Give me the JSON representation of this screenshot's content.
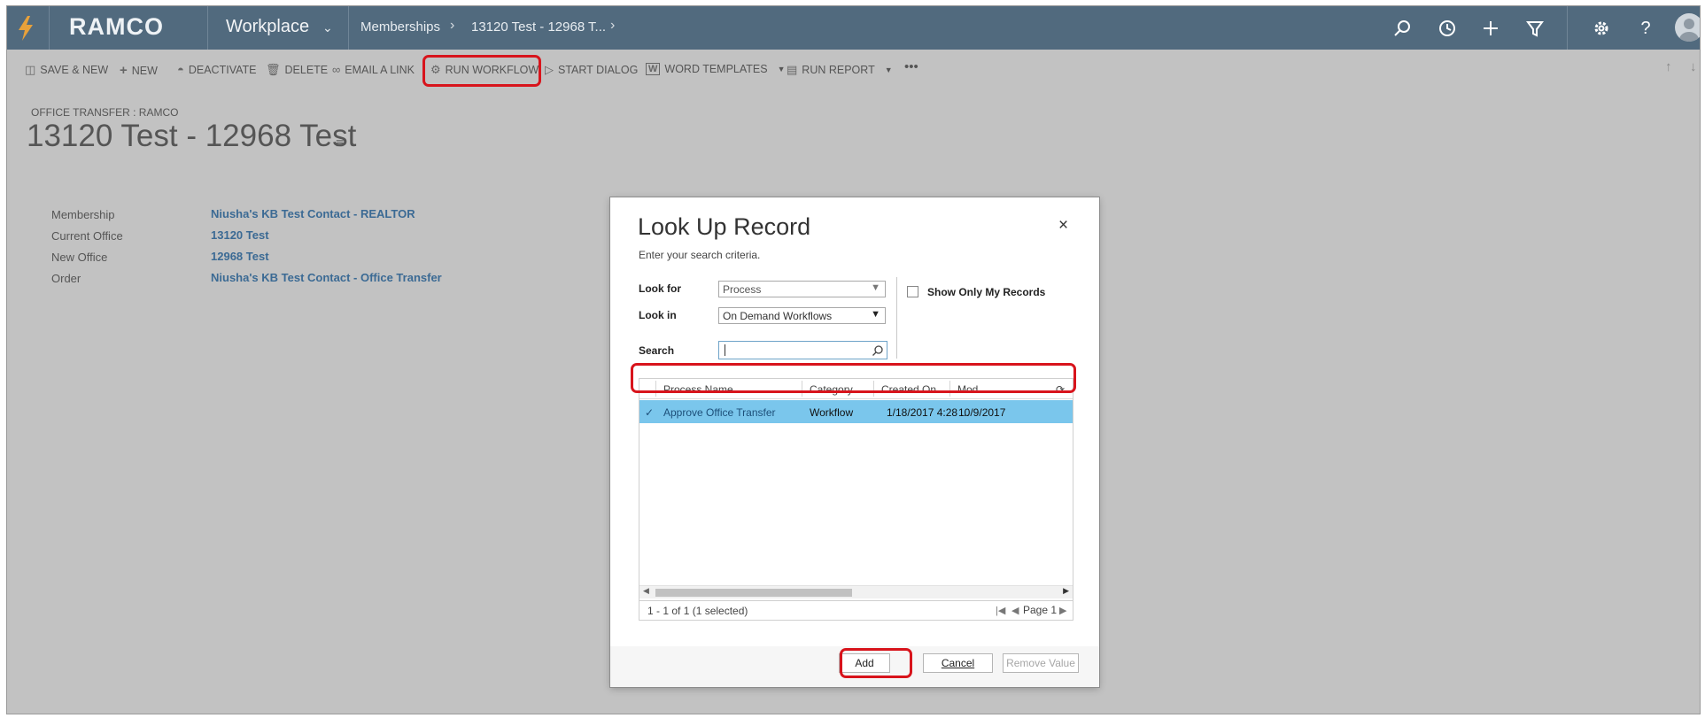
{
  "nav": {
    "logo_text": "RAMCO",
    "app_name": "Workplace",
    "breadcrumbs": [
      "Memberships",
      "13120 Test - 12968 T..."
    ],
    "icons": [
      "search-icon",
      "history-icon",
      "plus-icon",
      "filter-icon",
      "settings-icon",
      "help-icon",
      "user-avatar"
    ]
  },
  "commandbar": {
    "items": [
      {
        "label": "SAVE & NEW",
        "icon": "save-new-icon"
      },
      {
        "label": "NEW",
        "icon": "plus-icon"
      },
      {
        "label": "DEACTIVATE",
        "icon": "deactivate-icon"
      },
      {
        "label": "DELETE",
        "icon": "trash-icon"
      },
      {
        "label": "EMAIL A LINK",
        "icon": "link-icon"
      },
      {
        "label": "RUN WORKFLOW",
        "icon": "workflow-icon"
      },
      {
        "label": "START DIALOG",
        "icon": "dialog-icon"
      },
      {
        "label": "WORD TEMPLATES",
        "icon": "word-icon"
      },
      {
        "label": "RUN REPORT",
        "icon": "report-icon"
      }
    ],
    "more": "•••"
  },
  "record": {
    "entity_label": "OFFICE TRANSFER : RAMCO",
    "title": "13120 Test - 12968 Test",
    "fields": [
      {
        "label": "Membership",
        "value": "Niusha's KB Test Contact - REALTOR"
      },
      {
        "label": "Current Office",
        "value": "13120 Test"
      },
      {
        "label": "New Office",
        "value": "12968 Test"
      },
      {
        "label": "Order",
        "value": "Niusha's KB Test Contact - Office Transfer"
      }
    ]
  },
  "dialog": {
    "title": "Look Up Record",
    "subtitle": "Enter your search criteria.",
    "close": "×",
    "look_for_label": "Look for",
    "look_for_value": "Process",
    "look_in_label": "Look in",
    "look_in_value": "On Demand Workflows",
    "search_label": "Search",
    "search_value": "",
    "show_only_mine_label": "Show Only My Records",
    "show_only_mine_checked": false,
    "grid": {
      "columns": [
        "Process Name",
        "Category",
        "Created On",
        "Mod"
      ],
      "rows": [
        {
          "selected": true,
          "process_name": "Approve Office Transfer",
          "category": "Workflow",
          "created_on": "1/18/2017 4:28 ...",
          "modified_on": "10/9/2017"
        }
      ]
    },
    "status": "1 - 1 of 1 (1 selected)",
    "page_label": "Page 1",
    "buttons": {
      "add": "Add",
      "cancel": "Cancel",
      "remove": "Remove Value"
    }
  },
  "colors": {
    "nav_bg": "#516a7e",
    "selected_row": "#7ac6ec",
    "highlight": "#d8141c",
    "link": "#3b6a94"
  }
}
